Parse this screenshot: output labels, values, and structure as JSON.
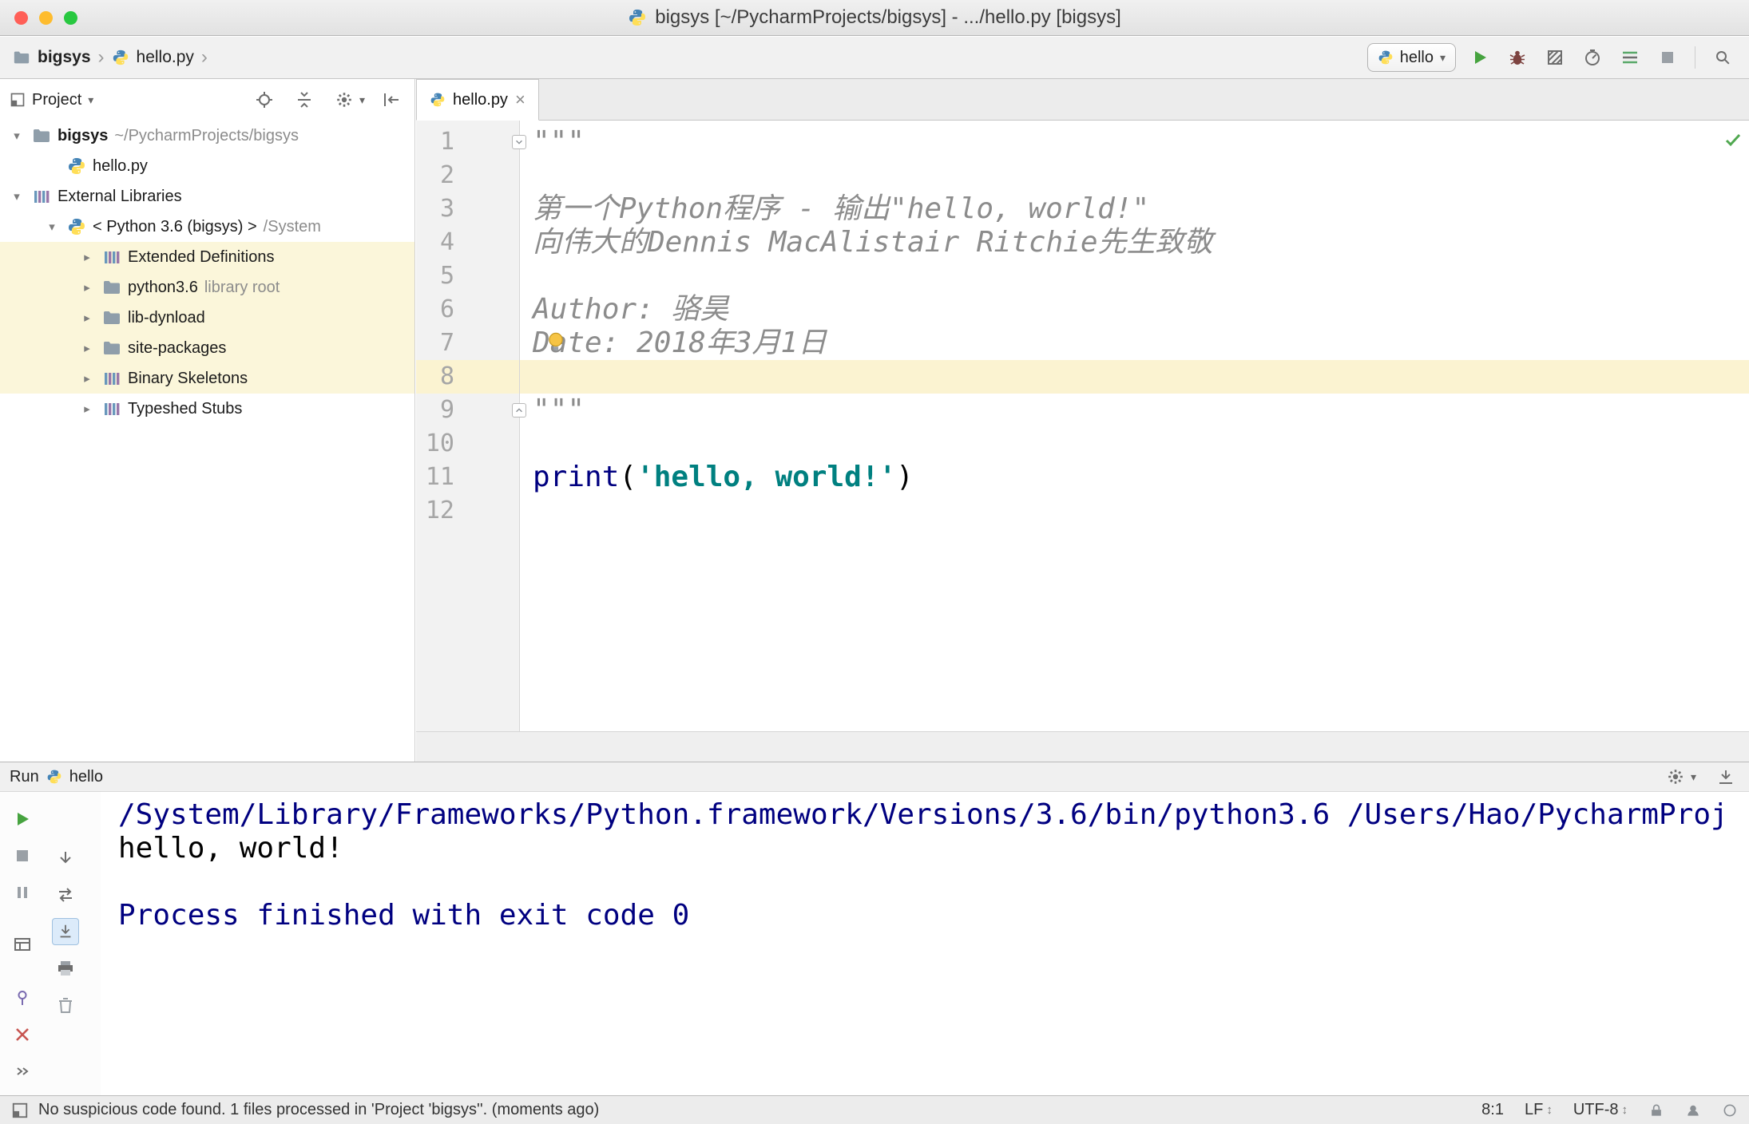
{
  "colors": {
    "run_green": "#46a33f",
    "string_teal": "#008080",
    "keyword_blue": "#000080",
    "doc_gray": "#8c8c8c",
    "console_navy": "#000080",
    "caret_line_yellow": "#fbf3d1",
    "tree_highlight_yellow": "#fbf6da",
    "error_red": "#c75450"
  },
  "title_bar": {
    "title": "bigsys [~/PycharmProjects/bigsys] - .../hello.py [bigsys]"
  },
  "toolbar": {
    "breadcrumbs": [
      {
        "label": "bigsys"
      },
      {
        "label": "hello.py"
      }
    ],
    "run_config": "hello"
  },
  "project_panel": {
    "header": "Project",
    "tree": [
      {
        "label": "bigsys",
        "suffix": "~/PycharmProjects/bigsys",
        "icon": "folder",
        "chevron": "down",
        "indent": 0,
        "bold": true
      },
      {
        "label": "hello.py",
        "icon": "python",
        "indent": 1
      },
      {
        "label": "External Libraries",
        "icon": "library",
        "chevron": "down",
        "indent": 0
      },
      {
        "label": "< Python 3.6 (bigsys) >",
        "suffix": "/System",
        "icon": "python",
        "chevron": "down",
        "indent": 1
      },
      {
        "label": "Extended Definitions",
        "icon": "library",
        "chevron": "right",
        "indent": 2,
        "highlight": true
      },
      {
        "label": "python3.6",
        "suffix": "library root",
        "icon": "folder",
        "chevron": "right",
        "indent": 2,
        "highlight": true
      },
      {
        "label": "lib-dynload",
        "icon": "folder",
        "chevron": "right",
        "indent": 2,
        "highlight": true
      },
      {
        "label": "site-packages",
        "icon": "folder",
        "chevron": "right",
        "indent": 2,
        "highlight": true
      },
      {
        "label": "Binary Skeletons",
        "icon": "library",
        "chevron": "right",
        "indent": 2,
        "highlight": true
      },
      {
        "label": "Typeshed Stubs",
        "icon": "library",
        "chevron": "right",
        "indent": 2
      }
    ]
  },
  "editor": {
    "tab": "hello.py",
    "lines": [
      {
        "n": 1,
        "segments": [
          {
            "t": "\"\"\"",
            "c": "doc"
          }
        ],
        "fold": "start"
      },
      {
        "n": 2,
        "segments": []
      },
      {
        "n": 3,
        "segments": [
          {
            "t": "第一个Python程序 - 输出\"hello, world!\"",
            "c": "doc"
          }
        ]
      },
      {
        "n": 4,
        "segments": [
          {
            "t": "向伟大的Dennis MacAlistair Ritchie先生致敬",
            "c": "doc"
          }
        ]
      },
      {
        "n": 5,
        "segments": []
      },
      {
        "n": 6,
        "segments": [
          {
            "t": "Author: 骆昊",
            "c": "doc"
          }
        ]
      },
      {
        "n": 7,
        "segments": [
          {
            "t": "Date: 2018年3月1日",
            "c": "doc"
          }
        ],
        "bulb": true
      },
      {
        "n": 8,
        "segments": [],
        "caret_line": true
      },
      {
        "n": 9,
        "segments": [
          {
            "t": "\"\"\"",
            "c": "doc"
          }
        ],
        "fold": "end"
      },
      {
        "n": 10,
        "segments": []
      },
      {
        "n": 11,
        "segments": [
          {
            "t": "print",
            "c": "func"
          },
          {
            "t": "(",
            "c": "plain"
          },
          {
            "t": "'hello, world!'",
            "c": "str"
          },
          {
            "t": ")",
            "c": "plain"
          }
        ]
      },
      {
        "n": 12,
        "segments": []
      }
    ]
  },
  "run_panel": {
    "title": "Run",
    "config": "hello",
    "console": [
      {
        "text": "/System/Library/Frameworks/Python.framework/Versions/3.6/bin/python3.6 /Users/Hao/PycharmProj",
        "color": "cmd"
      },
      {
        "text": "hello, world!",
        "color": "out"
      },
      {
        "text": "",
        "color": "out"
      },
      {
        "text": "Process finished with exit code 0",
        "color": "sys"
      }
    ]
  },
  "status_bar": {
    "message": "No suspicious code found. 1 files processed in 'Project 'bigsys''. (moments ago)",
    "caret_position": "8:1",
    "line_separator": "LF",
    "encoding": "UTF-8"
  }
}
